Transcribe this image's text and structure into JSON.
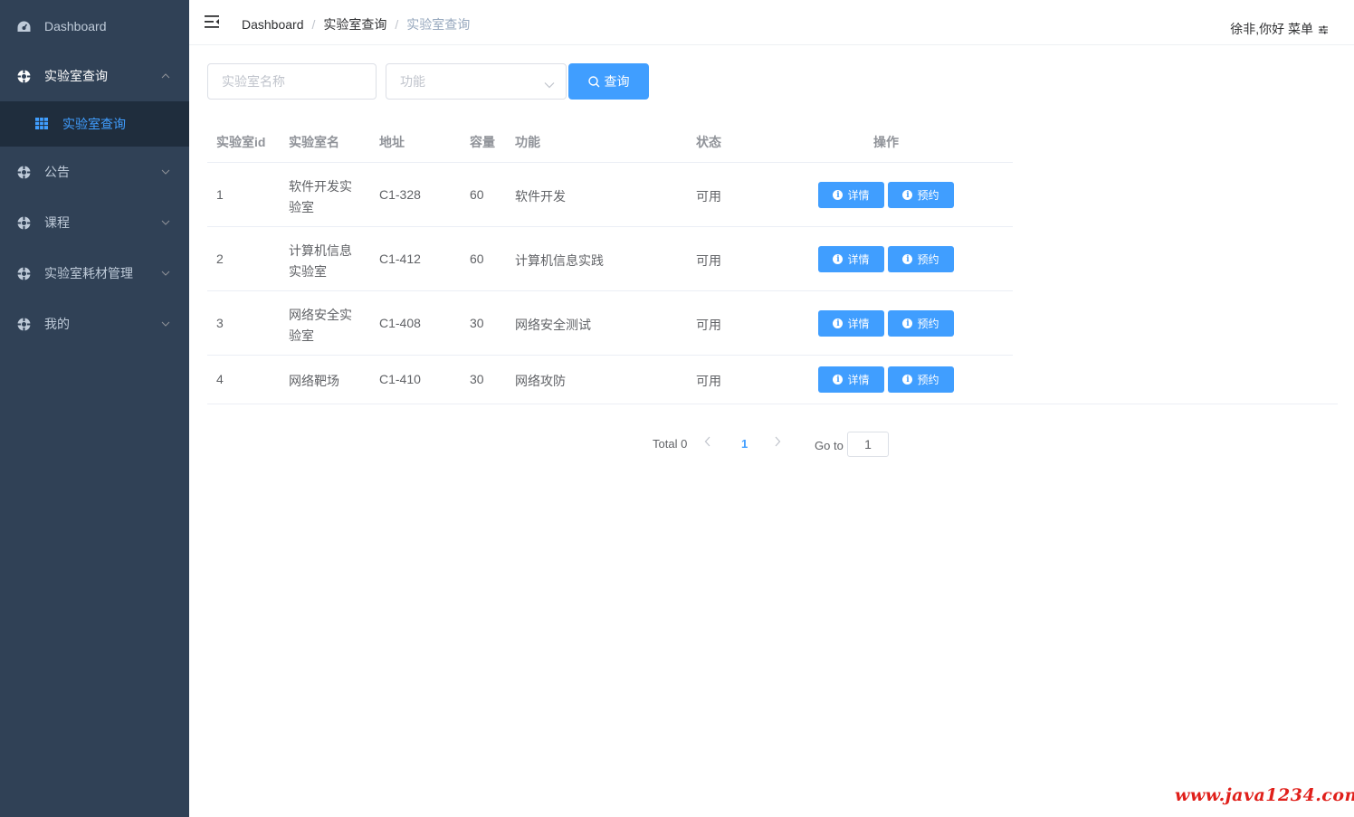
{
  "sidebar": {
    "items": [
      {
        "label": "Dashboard",
        "icon": "dashboard-icon"
      },
      {
        "label": "实验室查询",
        "icon": "component-icon"
      },
      {
        "label": "公告",
        "icon": "component-icon"
      },
      {
        "label": "课程",
        "icon": "component-icon"
      },
      {
        "label": "实验室耗材管理",
        "icon": "component-icon"
      },
      {
        "label": "我的",
        "icon": "component-icon"
      }
    ],
    "sub_item": {
      "label": "实验室查询",
      "icon": "table-icon"
    },
    "bg_color": "#304156",
    "active_color": "#409eff"
  },
  "navbar": {
    "breadcrumb": [
      "Dashboard",
      "实验室查询",
      "实验室查询"
    ],
    "user_text": "徐非,你好 菜单"
  },
  "filters": {
    "lab_name_placeholder": "实验室名称",
    "function_placeholder": "功能",
    "search_label": "查询"
  },
  "table": {
    "headers": [
      "实验室id",
      "实验室名",
      "地址",
      "容量",
      "功能",
      "状态",
      "操作"
    ],
    "rows": [
      {
        "id": "1",
        "name_line1": "软件开发实",
        "name_line2": "验室",
        "address": "C1-328",
        "capacity": "60",
        "function": "软件开发",
        "status": "可用"
      },
      {
        "id": "2",
        "name_line1": "计算机信息",
        "name_line2": "实验室",
        "address": "C1-412",
        "capacity": "60",
        "function": "计算机信息实践",
        "status": "可用"
      },
      {
        "id": "3",
        "name_line1": "网络安全实",
        "name_line2": "验室",
        "address": "C1-408",
        "capacity": "30",
        "function": "网络安全测试",
        "status": "可用"
      },
      {
        "id": "4",
        "name_line1": "网络靶场",
        "name_line2": "",
        "address": "C1-410",
        "capacity": "30",
        "function": "网络攻防",
        "status": "可用"
      }
    ],
    "detail_label": "详情",
    "reserve_label": "预约"
  },
  "pagination": {
    "total_text": "Total 0",
    "current_page": "1",
    "goto_label": "Go to",
    "goto_value": "1"
  },
  "watermark": "www.java1234.com",
  "colors": {
    "primary": "#409eff",
    "watermark": "#e0201b"
  }
}
